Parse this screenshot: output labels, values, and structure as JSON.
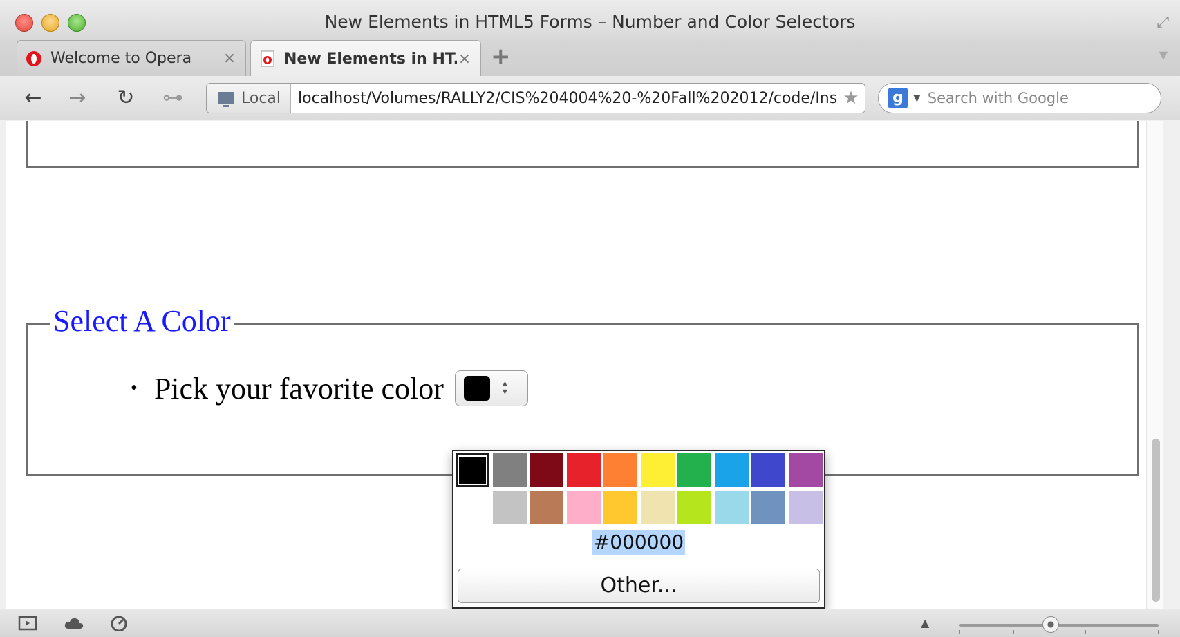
{
  "window": {
    "title": "New Elements in HTML5 Forms – Number and Color Selectors"
  },
  "tabs": [
    {
      "label": "Welcome to Opera",
      "close": "×",
      "active": false
    },
    {
      "label": "New Elements in HT...",
      "close": "×",
      "active": true
    }
  ],
  "new_tab": "+",
  "toolbar": {
    "back": "←",
    "forward": "→",
    "reload": "↻",
    "key": "⊶"
  },
  "address": {
    "badge": "Local",
    "url": "localhost/Volumes/RALLY2/CIS%204004%20-%20Fall%202012/code/Insid",
    "star": "★"
  },
  "search": {
    "engine_letter": "g",
    "placeholder": "Search with Google"
  },
  "page": {
    "legend": "Select A Color",
    "item_label": "Pick your favorite color",
    "bullet": "•"
  },
  "color_picker": {
    "row1": [
      "#000000",
      "#808080",
      "#7f0a17",
      "#e8222b",
      "#fe8133",
      "#feef35",
      "#23b14d",
      "#1ba3e9",
      "#3f47cc",
      "#a349a3"
    ],
    "row2": [
      "#c3c3c3",
      "#b97a57",
      "#feaec9",
      "#fec82e",
      "#efe4b0",
      "#b5e51d",
      "#99d9ea",
      "#7092bf",
      "#c8bfe7"
    ],
    "selected": "#000000",
    "hex_value": "#000000",
    "other_label": "Other..."
  },
  "statusbar": {
    "panel_icon": "panel-toggle",
    "sync_icon": "cloud",
    "turbo_icon": "speedometer",
    "zoom_caret": "▲"
  },
  "colors": {
    "legend": "#1919ff",
    "hex_highlight": "#b4d5fe"
  }
}
